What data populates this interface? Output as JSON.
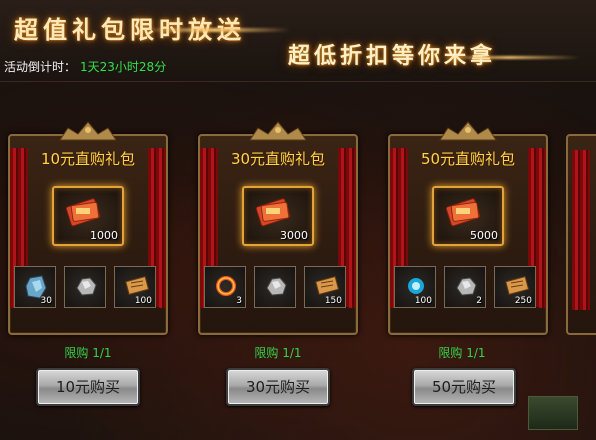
{
  "header": {
    "title": "超值礼包限时放送",
    "subtitle": "超低折扣等你来拿",
    "countdown_label": "活动倒计时：",
    "countdown_value": "1天23小时28分"
  },
  "packages": [
    {
      "title": "10元直购礼包",
      "main_item": {
        "icon": "ticket-bundle-icon",
        "qty": "1000"
      },
      "items": [
        {
          "icon": "blue-stone-icon",
          "qty": "30"
        },
        {
          "icon": "silver-ore-icon",
          "qty": ""
        },
        {
          "icon": "scroll-icon",
          "qty": "100"
        }
      ],
      "limit": "限购 1/1",
      "button": "10元购买"
    },
    {
      "title": "30元直购礼包",
      "main_item": {
        "icon": "ticket-bundle-icon",
        "qty": "3000"
      },
      "items": [
        {
          "icon": "fire-ring-icon",
          "qty": "3"
        },
        {
          "icon": "silver-ore-icon",
          "qty": ""
        },
        {
          "icon": "scroll-icon",
          "qty": "150"
        }
      ],
      "limit": "限购 1/1",
      "button": "30元购买"
    },
    {
      "title": "50元直购礼包",
      "main_item": {
        "icon": "ticket-bundle-icon",
        "qty": "5000"
      },
      "items": [
        {
          "icon": "blue-orb-icon",
          "qty": "100"
        },
        {
          "icon": "silver-ore-icon",
          "qty": "2"
        },
        {
          "icon": "scroll-icon",
          "qty": "250"
        }
      ],
      "limit": "限购 1/1",
      "button": "50元购买"
    }
  ],
  "colors": {
    "accent_gold": "#ffd44a",
    "limit_green": "#37d24a",
    "countdown_green": "#34e04a",
    "curtain_red": "#b0141a"
  }
}
